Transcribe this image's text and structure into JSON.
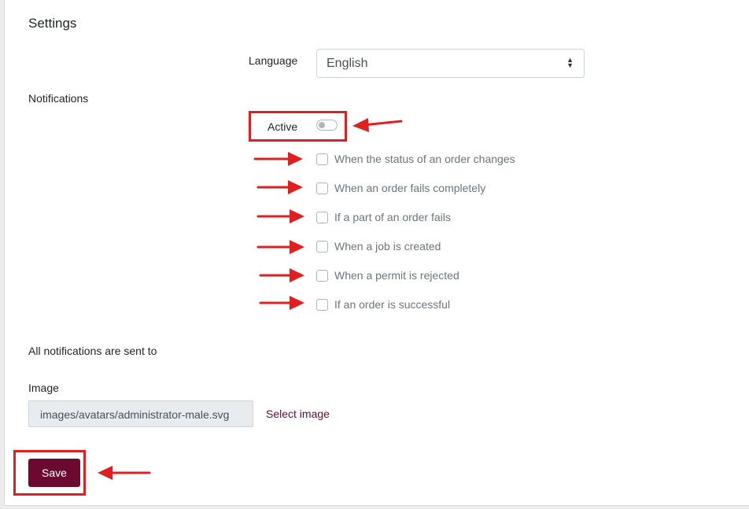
{
  "section_title": "Settings",
  "language": {
    "label": "Language",
    "selected": "English"
  },
  "notifications": {
    "label": "Notifications",
    "active_label": "Active",
    "active_on": false,
    "options": [
      {
        "label": "When the status of an order changes",
        "checked": false
      },
      {
        "label": "When an order fails completely",
        "checked": false
      },
      {
        "label": "If a part of an order fails",
        "checked": false
      },
      {
        "label": "When a job is created",
        "checked": false
      },
      {
        "label": "When a permit is rejected",
        "checked": false
      },
      {
        "label": "If an order is successful",
        "checked": false
      }
    ],
    "sent_to_label": "All notifications are sent to"
  },
  "image": {
    "label": "Image",
    "value": "images/avatars/administrator-male.svg",
    "select_link": "Select image"
  },
  "save_label": "Save",
  "colors": {
    "annotation": "#e02020",
    "save_button": "#6a0a30",
    "link": "#5a1132"
  }
}
